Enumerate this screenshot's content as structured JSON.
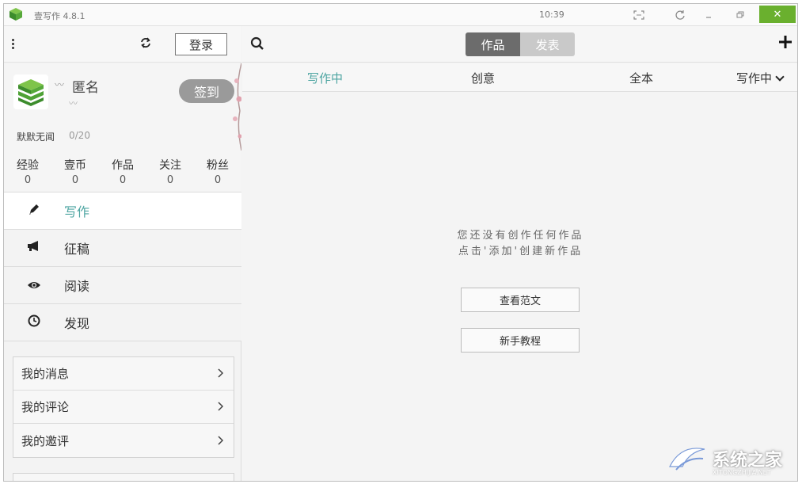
{
  "titlebar": {
    "app_title": "壹写作  4.8.1",
    "time": "10:39",
    "close_symbol": "✕"
  },
  "sidebar": {
    "login_label": "登录",
    "profile": {
      "username": "匿名",
      "signin_label": "签到",
      "motto": "默默无闻",
      "motto_count": "0/20",
      "stats": [
        {
          "label": "经验",
          "value": "0"
        },
        {
          "label": "壹币",
          "value": "0"
        },
        {
          "label": "作品",
          "value": "0"
        },
        {
          "label": "关注",
          "value": "0"
        },
        {
          "label": "粉丝",
          "value": "0"
        }
      ]
    },
    "nav": [
      {
        "label": "写作",
        "icon": "pencil-icon",
        "active": true
      },
      {
        "label": "征稿",
        "icon": "megaphone-icon",
        "active": false
      },
      {
        "label": "阅读",
        "icon": "eye-icon",
        "active": false
      },
      {
        "label": "发现",
        "icon": "clock-icon",
        "active": false
      }
    ],
    "links": [
      {
        "label": "我的消息"
      },
      {
        "label": "我的评论"
      },
      {
        "label": "我的邀评"
      }
    ]
  },
  "main": {
    "segments": [
      {
        "label": "作品",
        "selected": true
      },
      {
        "label": "发表",
        "selected": false
      }
    ],
    "filters": [
      "写作中",
      "创意",
      "全本"
    ],
    "filter_dropdown": "写作中",
    "empty_line1": "您还没有创作任何作品",
    "empty_line2": "点击'添加'创建新作品",
    "btn_sample": "查看范文",
    "btn_tutorial": "新手教程"
  },
  "watermark": {
    "text": "系统之家",
    "url": "XITONGZHIJIA.NET"
  },
  "colors": {
    "accent": "#4ea5a2",
    "close": "#6ab02e",
    "segment_on": "#6c6c6c",
    "segment_off": "#c9c9c9"
  }
}
